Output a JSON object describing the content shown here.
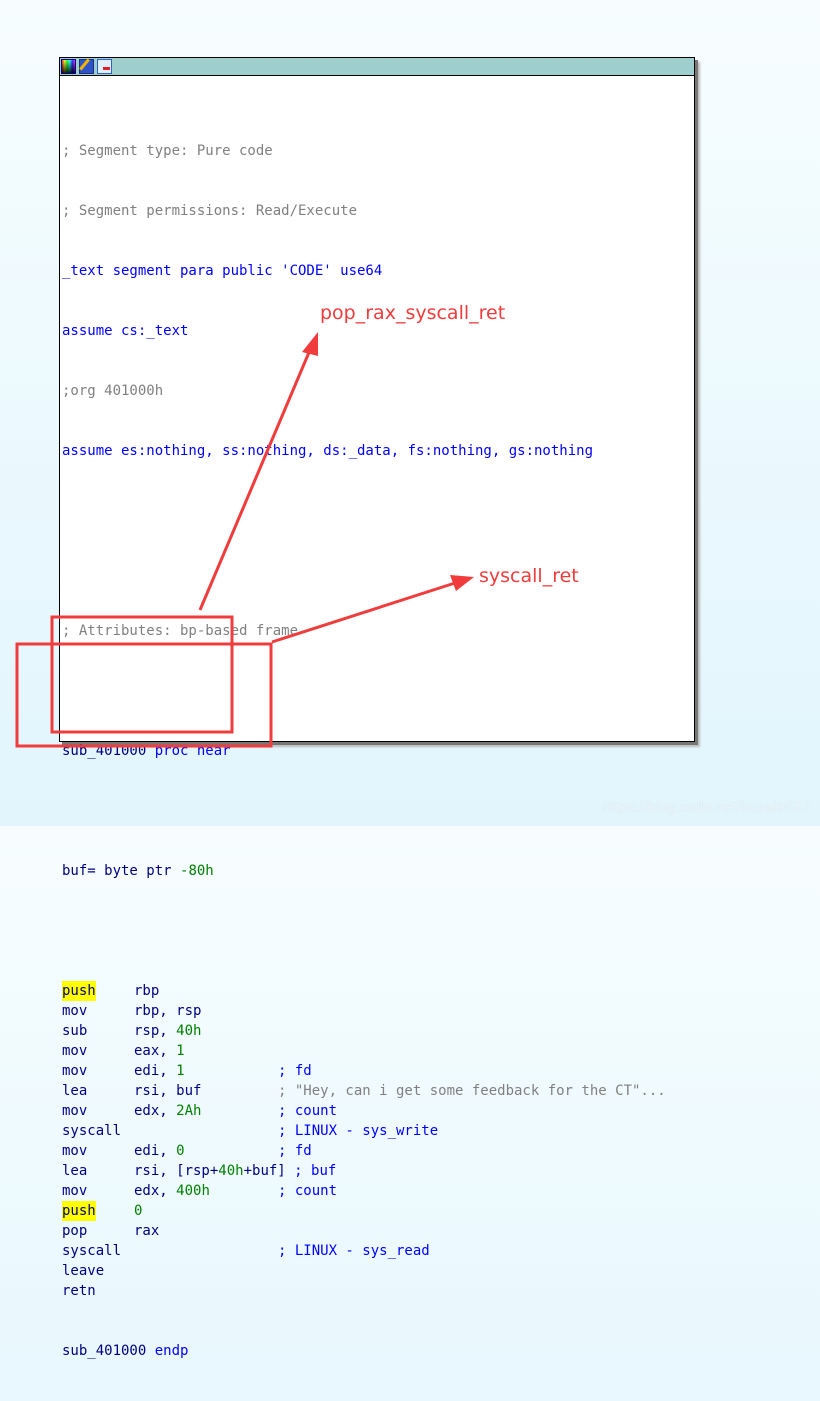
{
  "window": {
    "toolbar_icons": [
      "color-palette-icon",
      "edit-pencil-icon",
      "graph-view-icon"
    ]
  },
  "code": {
    "header": [
      "; Segment type: Pure code",
      "; Segment permissions: Read/Execute",
      "_text segment para public 'CODE' use64",
      "assume cs:_text",
      ";org 401000h",
      "assume es:nothing, ss:nothing, ds:_data, fs:nothing, gs:nothing"
    ],
    "attributes_comment": "; Attributes: bp-based frame",
    "proc_start": "sub_401000 proc near",
    "buf_decl": {
      "name": "buf= byte ptr ",
      "value": "-80h"
    },
    "instructions": [
      {
        "mnemonic": "push",
        "op1": "rbp",
        "op2": "",
        "comment": "",
        "highlight": true
      },
      {
        "mnemonic": "mov",
        "op1": "rbp, rsp",
        "op2": "",
        "comment": ""
      },
      {
        "mnemonic": "sub",
        "op1": "rsp, ",
        "op2": "40h",
        "comment": ""
      },
      {
        "mnemonic": "mov",
        "op1": "eax, ",
        "op2": "1",
        "comment": ""
      },
      {
        "mnemonic": "mov",
        "op1": "edi, ",
        "op2": "1",
        "comment": "; fd"
      },
      {
        "mnemonic": "lea",
        "op1": "rsi, buf",
        "op2": "",
        "comment": "; \"Hey, can i get some feedback for the CT\"..."
      },
      {
        "mnemonic": "mov",
        "op1": "edx, ",
        "op2": "2Ah",
        "comment": "; count"
      },
      {
        "mnemonic": "syscall",
        "op1": "",
        "op2": "",
        "comment": "; LINUX - sys_write"
      },
      {
        "mnemonic": "mov",
        "op1": "edi, ",
        "op2": "0",
        "comment": "; fd"
      },
      {
        "mnemonic": "lea",
        "op1": "rsi, [rsp+",
        "op2": "40h+buf] ; buf",
        "comment": ""
      },
      {
        "mnemonic": "mov",
        "op1": "edx, ",
        "op2": "400h",
        "comment": "; count"
      },
      {
        "mnemonic": "push",
        "op1": "",
        "op2": "0",
        "comment": "",
        "highlight": true
      },
      {
        "mnemonic": "pop",
        "op1": "rax",
        "op2": "",
        "comment": ""
      },
      {
        "mnemonic": "syscall",
        "op1": "",
        "op2": "",
        "comment": "; LINUX - sys_read"
      },
      {
        "mnemonic": "leave",
        "op1": "",
        "op2": "",
        "comment": ""
      },
      {
        "mnemonic": "retn",
        "op1": "",
        "op2": "",
        "comment": ""
      }
    ],
    "proc_end": {
      "name": "sub_401000 ",
      "keyword": "endp"
    }
  },
  "annotations": {
    "label_1": "pop_rax_syscall_ret",
    "label_2": "syscall_ret",
    "color": "#f03c3c"
  },
  "watermark": "https://blog.csdn.net/huzai9527"
}
